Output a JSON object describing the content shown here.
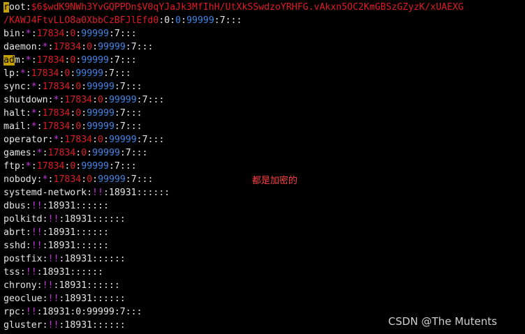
{
  "colors": {
    "background": "#000000",
    "text": "#e6e6e6",
    "hash": "#e01b24",
    "marker": "#c936e0",
    "day_count": "#3f86e8",
    "note": "#ff4040",
    "selection": "#c4a000"
  },
  "lines": [
    {
      "user": "root",
      "pw": "$6$wdK9NWh3YvGQPPDn$V0qYJaJk3MfIhH/UtXkSSwdzoYRHFG.vAkxn5OC2KmGBSzGZyzK/xUAEXG",
      "kind": "hash_start"
    },
    {
      "pw": "/KAWJ4FtvLLO8a0XbbCzBFJlEfd0",
      "last": "0",
      "min": "0",
      "max": "99999",
      "warn": "7",
      "tail": ":::",
      "kind": "hash_cont"
    },
    {
      "user": "bin",
      "pw": "*",
      "last": "17834",
      "min": "0",
      "max": "99999",
      "warn": "7",
      "tail": ":::"
    },
    {
      "user": "daemon",
      "pw": "*",
      "last": "17834",
      "min": "0",
      "max": "99999",
      "warn": "7",
      "tail": ":::"
    },
    {
      "user": "adm",
      "pw": "*",
      "last": "17834",
      "min": "0",
      "max": "99999",
      "warn": "7",
      "tail": ":::"
    },
    {
      "user": "lp",
      "pw": "*",
      "last": "17834",
      "min": "0",
      "max": "99999",
      "warn": "7",
      "tail": ":::"
    },
    {
      "user": "sync",
      "pw": "*",
      "last": "17834",
      "min": "0",
      "max": "99999",
      "warn": "7",
      "tail": ":::"
    },
    {
      "user": "shutdown",
      "pw": "*",
      "last": "17834",
      "min": "0",
      "max": "99999",
      "warn": "7",
      "tail": ":::"
    },
    {
      "user": "halt",
      "pw": "*",
      "last": "17834",
      "min": "0",
      "max": "99999",
      "warn": "7",
      "tail": ":::"
    },
    {
      "user": "mail",
      "pw": "*",
      "last": "17834",
      "min": "0",
      "max": "99999",
      "warn": "7",
      "tail": ":::"
    },
    {
      "user": "operator",
      "pw": "*",
      "last": "17834",
      "min": "0",
      "max": "99999",
      "warn": "7",
      "tail": ":::"
    },
    {
      "user": "games",
      "pw": "*",
      "last": "17834",
      "min": "0",
      "max": "99999",
      "warn": "7",
      "tail": ":::"
    },
    {
      "user": "ftp",
      "pw": "*",
      "last": "17834",
      "min": "0",
      "max": "99999",
      "warn": "7",
      "tail": ":::"
    },
    {
      "user": "nobody",
      "pw": "*",
      "last": "17834",
      "min": "0",
      "max": "99999",
      "warn": "7",
      "tail": ":::"
    },
    {
      "user": "systemd-network",
      "pw": "!!",
      "last": "18931",
      "tail": "::::::"
    },
    {
      "user": "dbus",
      "pw": "!!",
      "last": "18931",
      "tail": "::::::"
    },
    {
      "user": "polkitd",
      "pw": "!!",
      "last": "18931",
      "tail": "::::::"
    },
    {
      "user": "abrt",
      "pw": "!!",
      "last": "18931",
      "tail": "::::::"
    },
    {
      "user": "sshd",
      "pw": "!!",
      "last": "18931",
      "tail": "::::::"
    },
    {
      "user": "postfix",
      "pw": "!!",
      "last": "18931",
      "tail": "::::::"
    },
    {
      "user": "tss",
      "pw": "!!",
      "last": "18931",
      "tail": "::::::"
    },
    {
      "user": "chrony",
      "pw": "!!",
      "last": "18931",
      "tail": "::::::"
    },
    {
      "user": "geoclue",
      "pw": "!!",
      "last": "18931",
      "tail": "::::::"
    },
    {
      "user": "rpc",
      "pw": "!!",
      "last": "18931",
      "plain_rest": ":0:99999:7:::"
    },
    {
      "user": "gluster",
      "pw": "!!",
      "last": "18931",
      "tail": "::::::"
    }
  ],
  "annotation": "都是加密的",
  "watermark": "CSDN @The Mutents"
}
